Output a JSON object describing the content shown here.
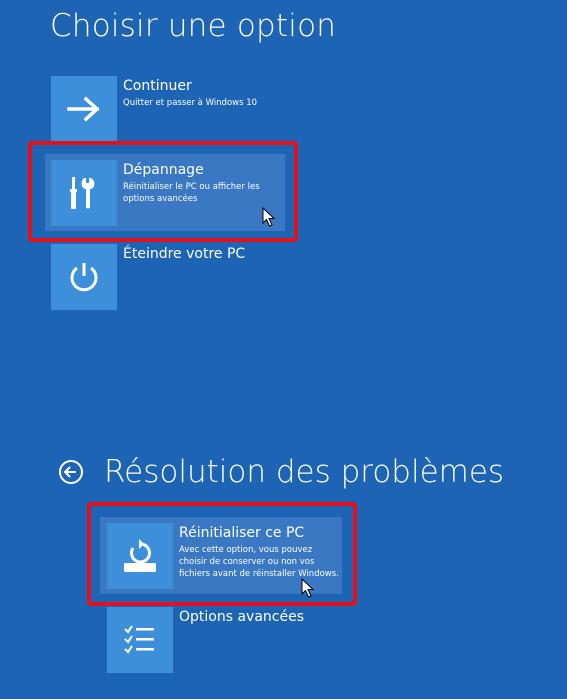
{
  "screen": {
    "title": "Choisir une option"
  },
  "options": {
    "continue": {
      "label": "Continuer",
      "description": "Quitter et passer à Windows 10",
      "icon": "arrow-right-icon"
    },
    "troubleshoot": {
      "label": "Dépannage",
      "description": "Réinitialiser le PC ou afficher les options avancées",
      "icon": "tools-icon"
    },
    "shutdown": {
      "label": "Éteindre votre PC",
      "icon": "power-icon"
    }
  },
  "troubleshoot_section": {
    "title": "Résolution des problèmes",
    "back_icon": "back-arrow-icon",
    "options": {
      "reset": {
        "label": "Réinitialiser ce PC",
        "description": "Avec cette option, vous pouvez choisir de conserver ou non vos fichiers avant de réinstaller Windows.",
        "icon": "reset-icon"
      },
      "advanced": {
        "label": "Options avancées",
        "icon": "checklist-icon"
      }
    }
  },
  "colors": {
    "background": "#1e64b4",
    "tile": "#3d8fd9",
    "hover": "#3a78c4",
    "annotation_red": "#e3111b"
  }
}
